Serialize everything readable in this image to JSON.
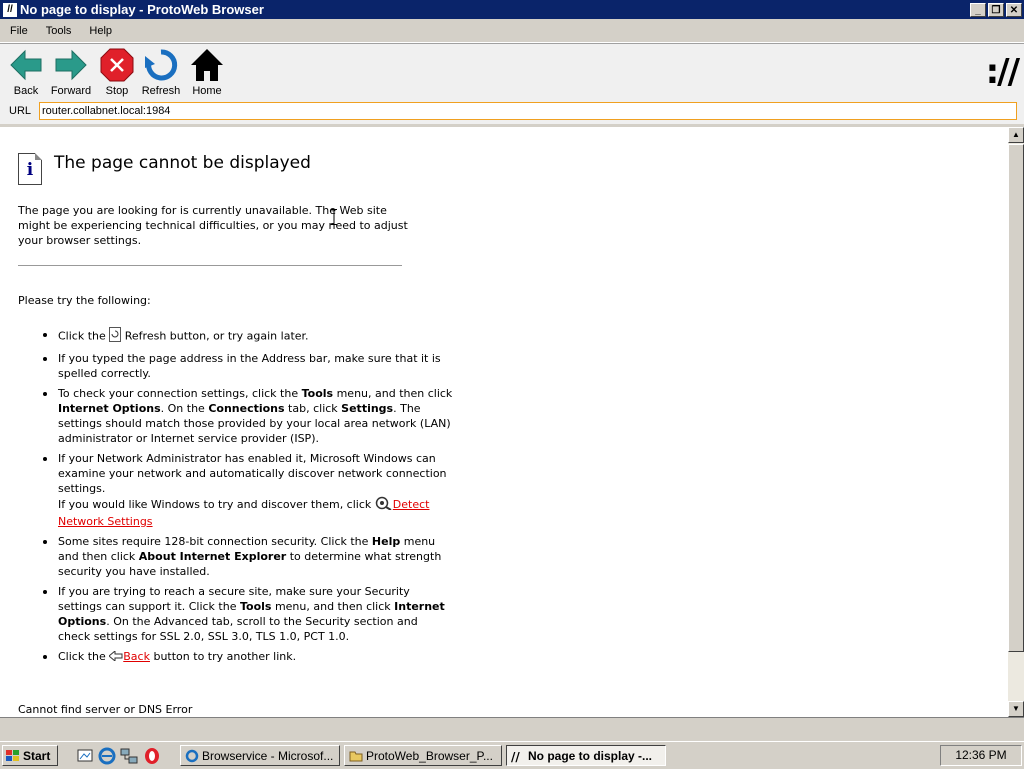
{
  "window": {
    "title": "No page to display - ProtoWeb Browser",
    "buttons": [
      "_",
      "❐",
      "✕"
    ]
  },
  "menu": [
    "File",
    "Tools",
    "Help"
  ],
  "toolbar": {
    "back": "Back",
    "forward": "Forward",
    "stop": "Stop",
    "refresh": "Refresh",
    "home": "Home",
    "brand": "://"
  },
  "urlbar": {
    "label": "URL",
    "value": "router.collabnet.local:1984"
  },
  "page": {
    "heading": "The page cannot be displayed",
    "intro": "The page you are looking for is currently unavailable. The Web site might be experiencing technical difficulties, or you may need to adjust your browser settings.",
    "try_label": "Please try the following:",
    "tip1_a": "Click the ",
    "tip1_b": " Refresh button, or try again later.",
    "tip2": "If you typed the page address in the Address bar, make sure that it is spelled correctly.",
    "tip3": {
      "a": "To check your connection settings, click the ",
      "b": "Tools",
      "c": " menu, and then click ",
      "d": "Internet Options",
      "e": ". On the ",
      "f": "Connections",
      "g": " tab, click ",
      "h": "Settings",
      "i": ". The settings should match those provided by your local area network (LAN) administrator or Internet service provider (ISP)."
    },
    "tip4": {
      "a": "If your Network Administrator has enabled it, Microsoft Windows can examine your network and automatically discover network connection settings.",
      "b": "If you would like Windows to try and discover them, click ",
      "link": "Detect Network Settings"
    },
    "tip5": {
      "a": "Some sites require 128-bit connection security. Click the ",
      "b": "Help",
      "c": " menu and then click ",
      "d": "About Internet Explorer",
      "e": " to determine what strength security you have installed."
    },
    "tip6": {
      "a": "If you are trying to reach a secure site, make sure your Security settings can support it. Click the ",
      "b": "Tools",
      "c": " menu, and then click ",
      "d": "Internet Options",
      "e": ". On the Advanced tab, scroll to the Security section and check settings for SSL 2.0, SSL 3.0, TLS 1.0, PCT 1.0."
    },
    "tip7": {
      "a": "Click the ",
      "link": "Back",
      "b": " button to try another link."
    },
    "footer": "Cannot find server or DNS Error"
  },
  "taskbar": {
    "start": "Start",
    "tasks": [
      "Browservice - Microsof...",
      "ProtoWeb_Browser_P...",
      "No page to display -..."
    ],
    "clock": "12:36 PM"
  },
  "colors": {
    "titlebar": "#0a246a",
    "arrow_teal": "#2a9a8a",
    "stop_red": "#e0202a",
    "link_red": "#e00000",
    "refresh_blue": "#1a6fc0"
  }
}
